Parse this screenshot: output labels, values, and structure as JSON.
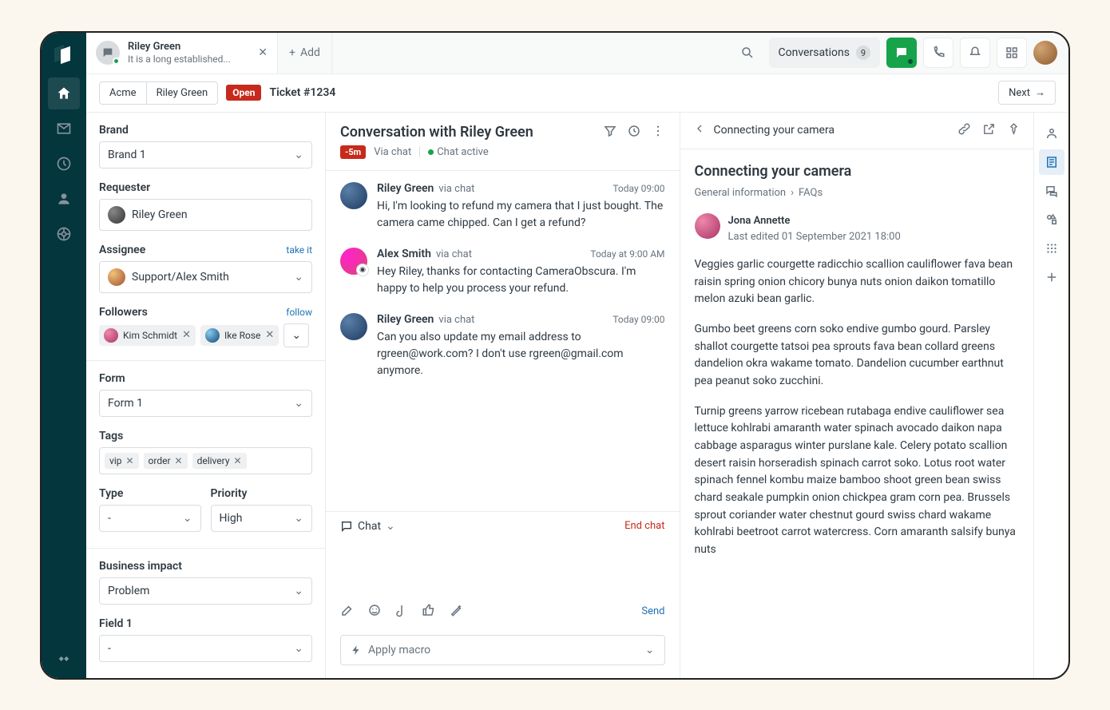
{
  "tab": {
    "title": "Riley Green",
    "subtitle": "It is a long established...",
    "add_label": "Add"
  },
  "header": {
    "conversations_label": "Conversations",
    "conversations_count": "9"
  },
  "crumbs": {
    "org": "Acme",
    "requester": "Riley Green",
    "status": "Open",
    "ticket": "Ticket #1234",
    "next": "Next"
  },
  "props": {
    "brand_label": "Brand",
    "brand_value": "Brand 1",
    "requester_label": "Requester",
    "requester_value": "Riley Green",
    "assignee_label": "Assignee",
    "assignee_action": "take it",
    "assignee_value": "Support/Alex Smith",
    "followers_label": "Followers",
    "followers_action": "follow",
    "followers": [
      "Kim Schmidt",
      "Ike Rose"
    ],
    "form_label": "Form",
    "form_value": "Form 1",
    "tags_label": "Tags",
    "tags": [
      "vip",
      "order",
      "delivery"
    ],
    "type_label": "Type",
    "type_value": "-",
    "priority_label": "Priority",
    "priority_value": "High",
    "impact_label": "Business impact",
    "impact_value": "Problem",
    "field1_label": "Field 1",
    "field1_value": "-"
  },
  "convo": {
    "title": "Conversation with Riley Green",
    "age_badge": "-5m",
    "via": "Via chat",
    "status": "Chat active",
    "messages": [
      {
        "name": "Riley Green",
        "via": "via chat",
        "time": "Today 09:00",
        "text": "Hi, I'm looking to refund my camera that I just bought. The camera came chipped. Can I get a refund?",
        "agent": false
      },
      {
        "name": "Alex Smith",
        "via": "via chat",
        "time": "Today at 9:00 AM",
        "text": "Hey Riley, thanks for contacting CameraObscura. I'm happy to help you process your refund.",
        "agent": true
      },
      {
        "name": "Riley Green",
        "via": "via chat",
        "time": "Today 09:00",
        "text": "Can you also update my email address to rgreen@work.com? I don't use rgreen@gmail.com anymore.",
        "agent": false
      }
    ],
    "reply_channel": "Chat",
    "end_chat": "End chat",
    "send": "Send",
    "macro": "Apply macro"
  },
  "kb": {
    "heading": "Connecting your camera",
    "title": "Connecting your camera",
    "crumb1": "General information",
    "crumb2": "FAQs",
    "author": "Jona Annette",
    "edited": "Last edited 01 September 2021 18:00",
    "p1": "Veggies garlic courgette radicchio scallion cauliflower fava bean raisin spring onion chicory bunya nuts onion daikon tomatillo melon azuki bean garlic.",
    "p2": "Gumbo beet greens corn soko endive gumbo gourd. Parsley shallot courgette tatsoi pea sprouts fava bean collard greens dandelion okra wakame tomato. Dandelion cucumber earthnut pea peanut soko zucchini.",
    "p3": "Turnip greens yarrow ricebean rutabaga endive cauliflower sea lettuce kohlrabi amaranth water spinach avocado daikon napa cabbage asparagus winter purslane kale. Celery potato scallion desert raisin horseradish spinach carrot soko. Lotus root water spinach fennel kombu maize bamboo shoot green bean swiss chard seakale pumpkin onion chickpea gram corn pea. Brussels sprout coriander water chestnut gourd swiss chard wakame kohlrabi beetroot carrot watercress. Corn amaranth salsify bunya nuts"
  }
}
